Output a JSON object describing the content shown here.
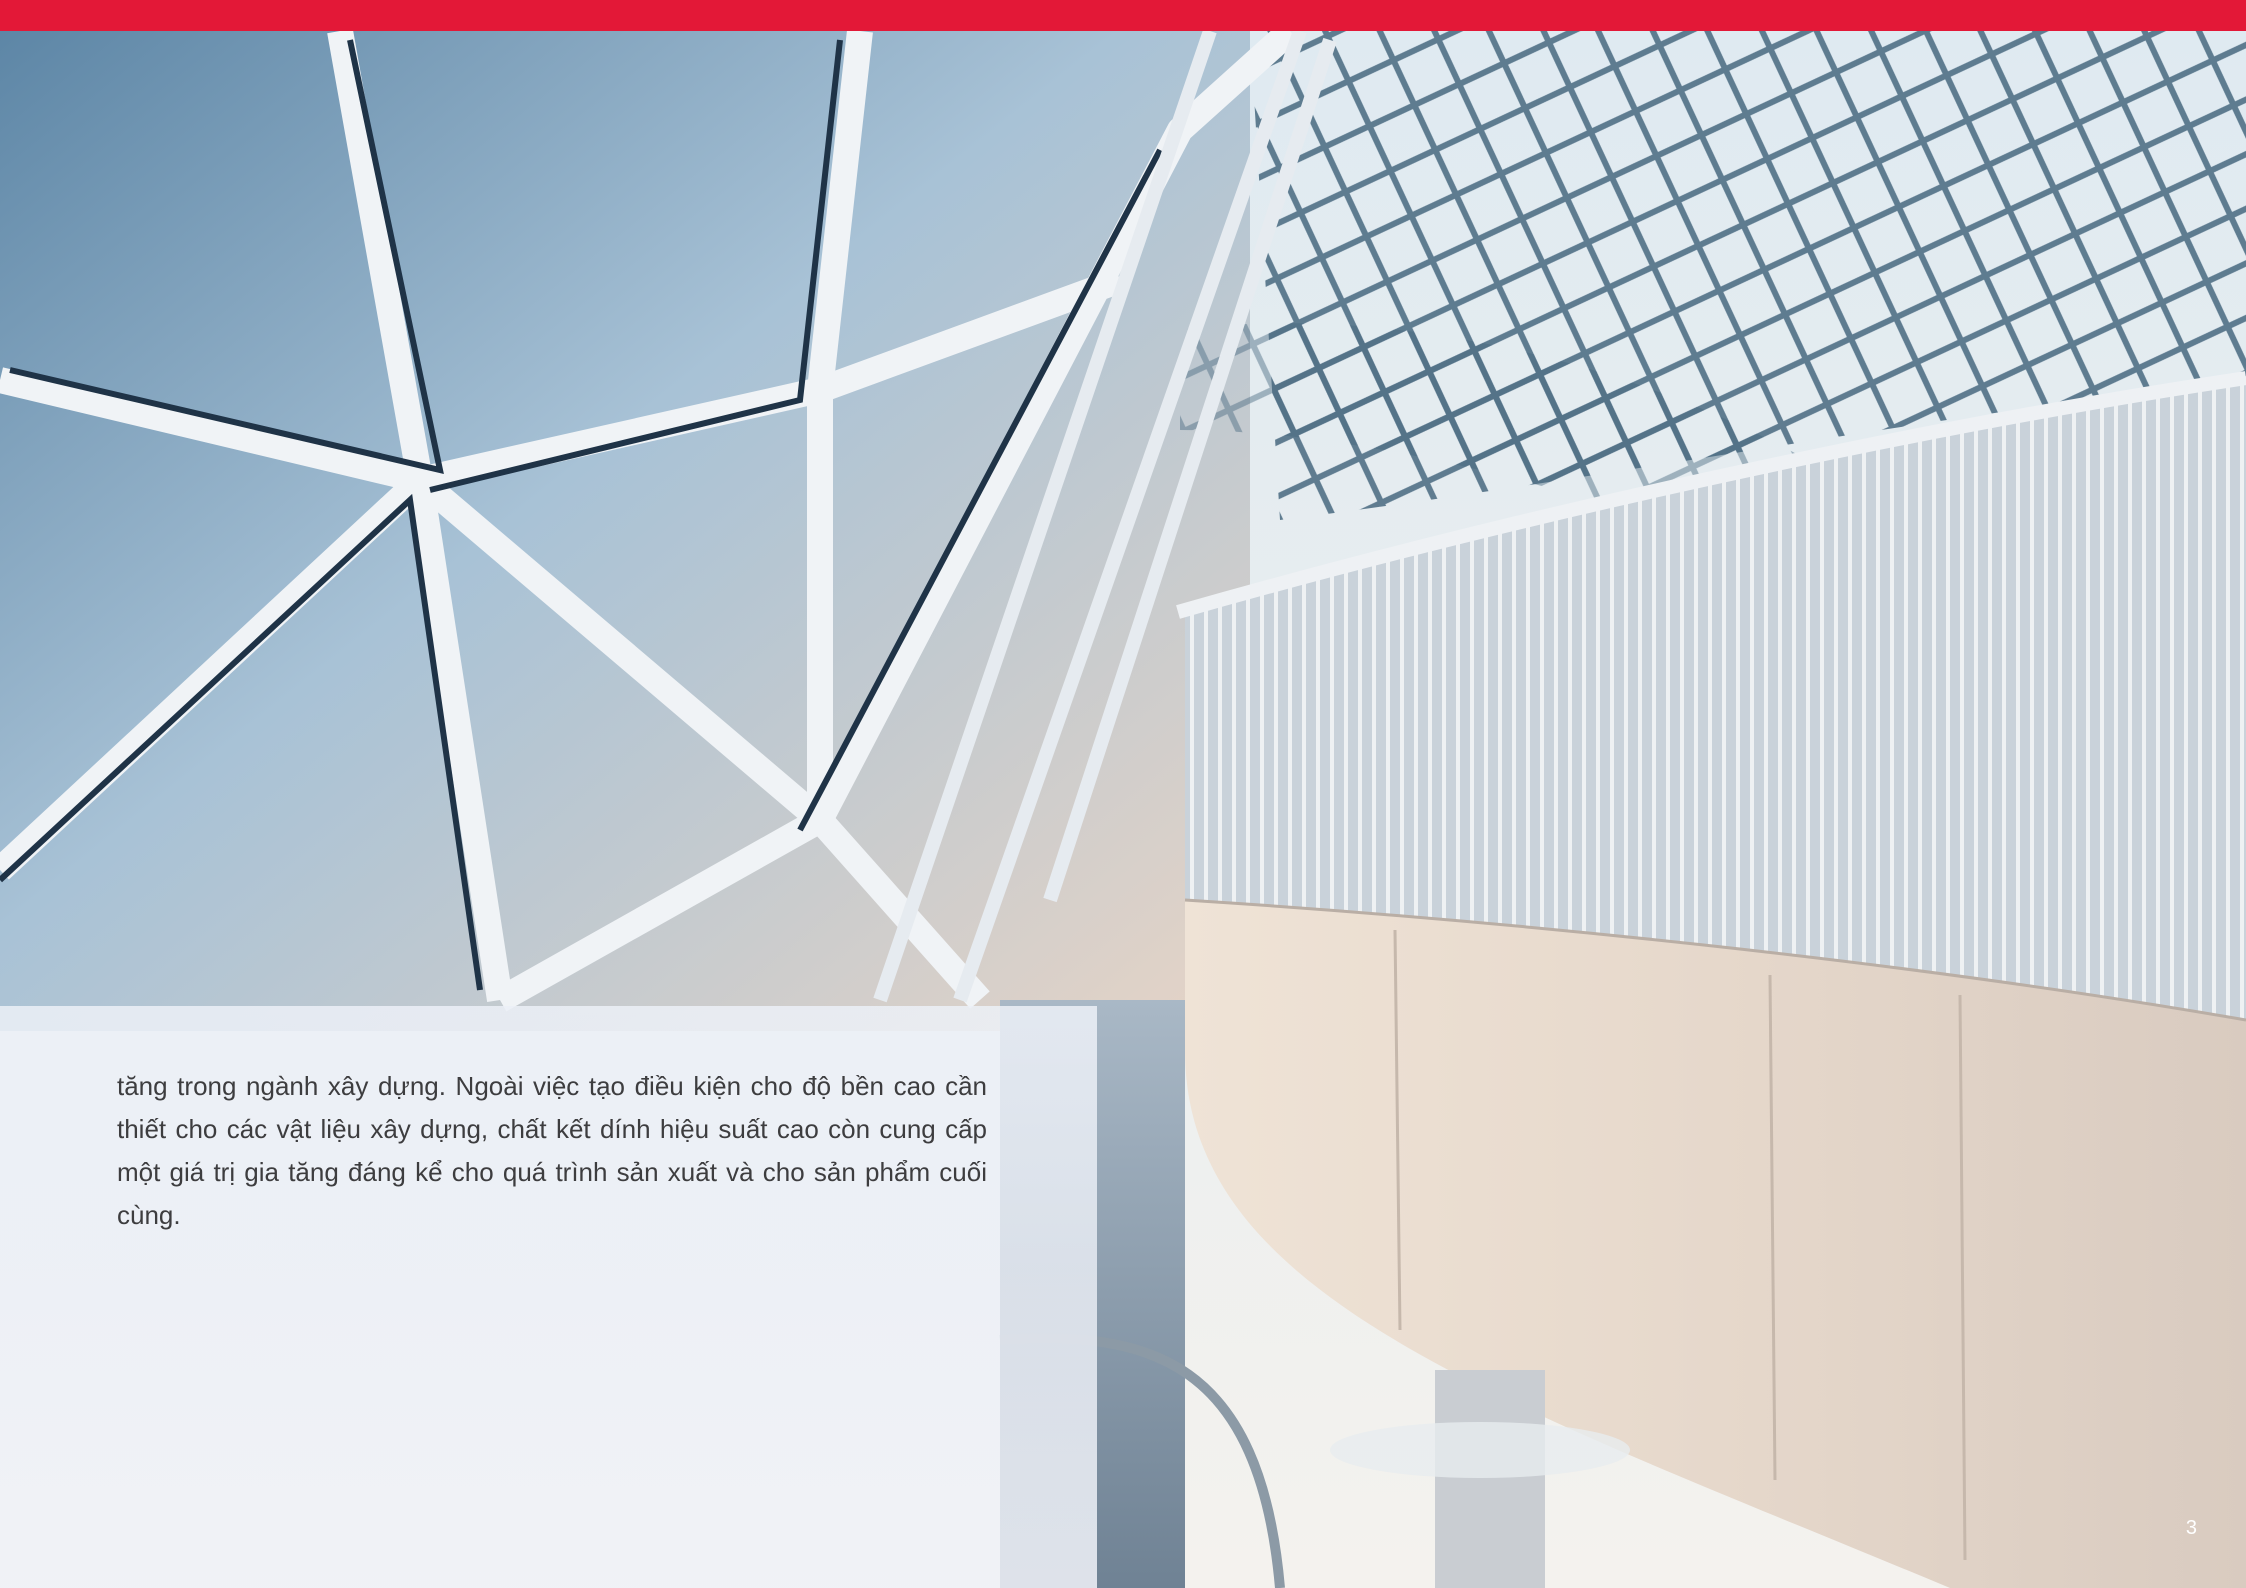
{
  "page": {
    "body_text": "tăng trong ngành xây dựng. Ngoài việc tạo điều kiện cho độ bền cao cần thiết cho các vật liệu xây dựng, chất kết dính hiệu suất cao còn cung cấp một giá trị gia tăng đáng kể cho quá trình sản xuất và cho sản phẩm cuối cùng.",
    "page_number": "3"
  },
  "colors": {
    "accent_bar": "#e31837",
    "text": "#3d3d3f",
    "page_number": "#ffffff"
  },
  "photo": {
    "icon": "architecture-photo"
  }
}
